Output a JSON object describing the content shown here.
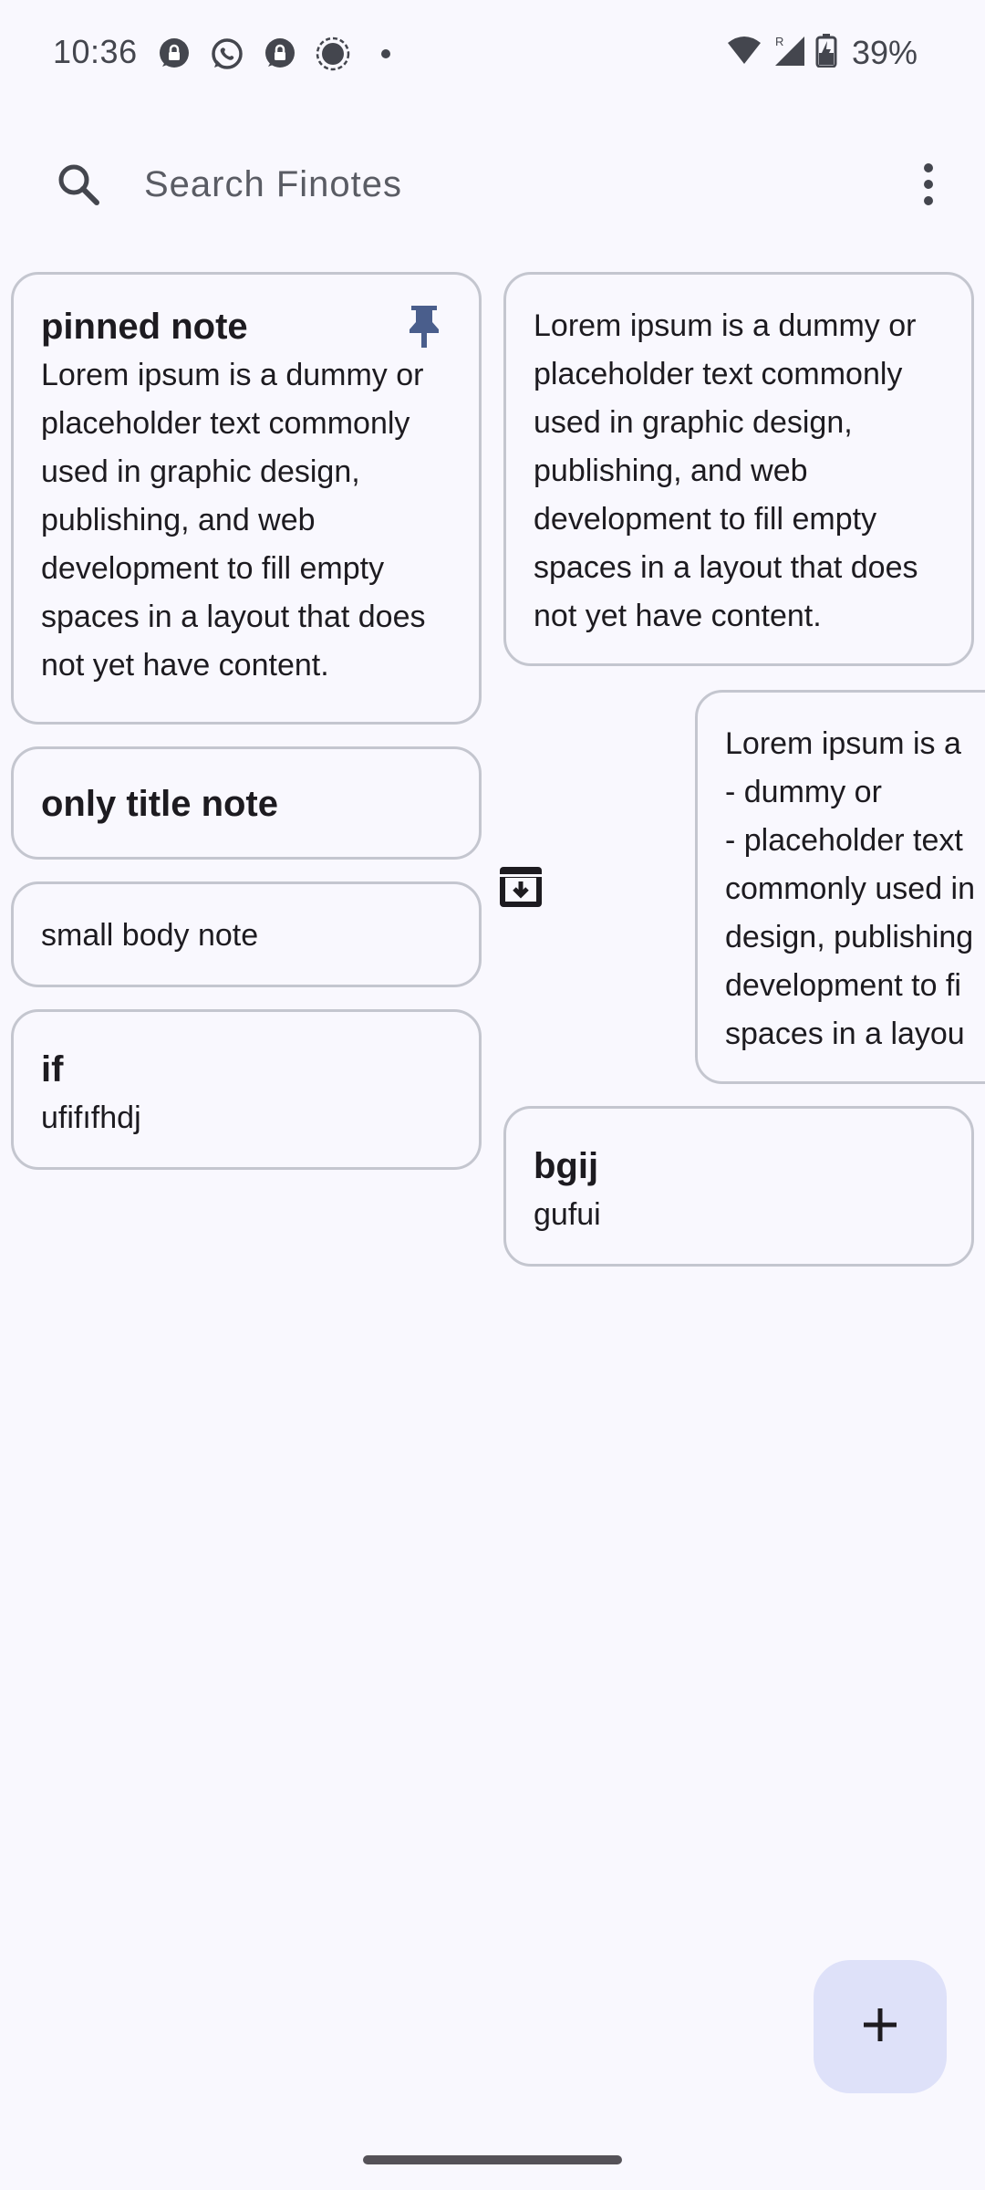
{
  "status_bar": {
    "time": "10:36",
    "battery": "39%",
    "notification_icons": [
      "signal-chat-icon",
      "whatsapp-icon",
      "signal-chat-icon",
      "signal-icon",
      "dot-icon"
    ],
    "system_icons": [
      "wifi-icon",
      "cellular-signal-roaming-icon",
      "battery-charging-icon"
    ]
  },
  "search": {
    "placeholder": "Search Finotes",
    "value": ""
  },
  "notes_left": [
    {
      "title": "pinned note",
      "body": "Lorem ipsum is a dummy or placeholder text commonly used in graphic design, publishing, and web development to fill empty spaces in a layout that does not yet have content.",
      "pinned": true
    },
    {
      "title": "only title note",
      "body": ""
    },
    {
      "title": "",
      "body": "small body note"
    },
    {
      "title": "if",
      "body": "ufifıfhdj"
    }
  ],
  "notes_right": [
    {
      "title": "",
      "body": "Lorem ipsum is a dummy or placeholder text commonly used in graphic design, publishing, and web development to fill empty spaces in a layout that does not yet have content."
    },
    {
      "title": "",
      "body": "Lorem ipsum is a\n- dummy or\n- placeholder text\ncommonly used in\ndesign, publishing\ndevelopment to fi\nspaces in a layou",
      "swiping": true,
      "swipe_action_icon": "archive-icon"
    },
    {
      "title": "bgij",
      "body": "gufui"
    }
  ],
  "fab": {
    "icon": "plus-icon"
  },
  "colors": {
    "background": "#F9F8FE",
    "card_border": "#C4C6CF",
    "pin": "#4A5E8C",
    "fab": "#DEE1F9",
    "text": "#1D1B20"
  }
}
